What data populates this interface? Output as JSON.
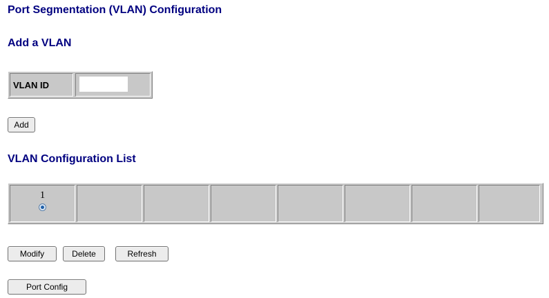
{
  "page": {
    "title": "Port Segmentation (VLAN) Configuration"
  },
  "add_vlan": {
    "heading": "Add a VLAN",
    "vlan_id_label": "VLAN ID",
    "vlan_id_value": "",
    "add_button": "Add"
  },
  "vlan_list": {
    "heading": "VLAN Configuration List",
    "entries": [
      {
        "vlan_id": "1",
        "selected": true
      }
    ],
    "empty_slots": 7
  },
  "actions": {
    "modify": "Modify",
    "delete": "Delete",
    "refresh": "Refresh",
    "port_config": "Port Config"
  },
  "colors": {
    "heading": "#000080",
    "table_bg": "#c8c8c8"
  }
}
